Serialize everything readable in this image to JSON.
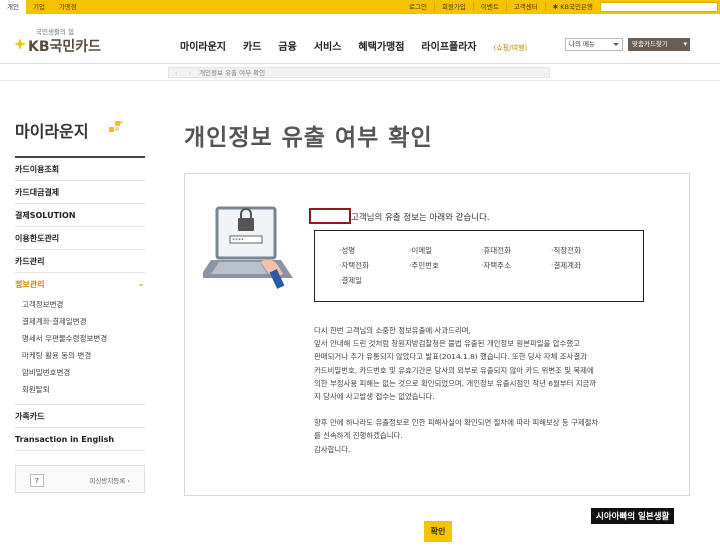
{
  "topbar": {
    "tabs": [
      "개인",
      "기업",
      "가맹점"
    ],
    "links": [
      "로그인",
      "회원가입",
      "이벤트",
      "고객센터",
      "KB국민은행"
    ]
  },
  "header": {
    "slogan": "국민생활의 힘",
    "logo_text": "KB국민카드",
    "gnb": [
      "마이라운지",
      "카드",
      "금융",
      "서비스",
      "혜택가맹점",
      "라이프플라자"
    ],
    "gnb_sub": "(쇼핑/여행)",
    "my_menu": "나의 메뉴",
    "card_find": "맞춤카드찾기"
  },
  "breadcrumb": {
    "prev": "‹",
    "next": "›",
    "text": "개인정보 유출 여부 확인"
  },
  "sidebar": {
    "title": "마이라운지",
    "items_top": [
      "카드이용조회",
      "카드대금결제",
      "결제SOLUTION",
      "이용한도관리",
      "카드관리"
    ],
    "active_item": "정보관리",
    "sub_items": [
      "고객정보변경",
      "결제계좌·결제일변경",
      "명세서 우편물수령정보변경",
      "마케팅 활용 동의 변경",
      "암비밀번호변경",
      "회원탈퇴"
    ],
    "items_bottom": [
      "가족카드",
      "Transaction in English"
    ],
    "help_icon": "?",
    "help_text": "피싱방지등록 ›"
  },
  "main": {
    "title": "개인정보 유출 여부 확인",
    "greeting": "고객님의 유출 정보는 아래와 같습니다.",
    "info_fields": [
      "·성명",
      "·이메일",
      "·휴대전화",
      "·직장전화",
      "·자택전화",
      "·주민번호",
      "·자택주소",
      "·결제계좌",
      "·결제일"
    ],
    "paragraphs": [
      [
        "다시 한번 고객님의 소중한 정보유출에 사과드리며,",
        "앞서 안내해 드린 것처럼 창원지방검찰청은 불법 유출된 개인정보 원본파일을 압수했고",
        "판매되거나 추가 유통되지 않았다고 발표(2014.1.8) 했습니다. 또한 당사 자체 조사결과",
        "카드비밀번호, 카드번호 및 유효기간은 당사의 외부로 유출되지 않아 카드 위변조 및 복제에",
        "의한 부정사용 피해는 없는 것으로 확인되었으며, 개인정보 유출시점인 작년 6월부터 지금까",
        "지 당사에 사고발생 접수는 없었습니다."
      ],
      [
        "향후 만에 하나라도 유출정보로 인한 피해사실이 확인되면 절차에 따라 피해보상 등 구제절차",
        "를 신속하게 진행하겠습니다.",
        "감사합니다."
      ]
    ],
    "confirm_label": "확인"
  },
  "watermark": "시아아빠의 일본생활",
  "colors": {
    "brand_yellow": "#f5c400",
    "brand_brown": "#6b5d54",
    "accent_red": "#8b1a1a"
  }
}
